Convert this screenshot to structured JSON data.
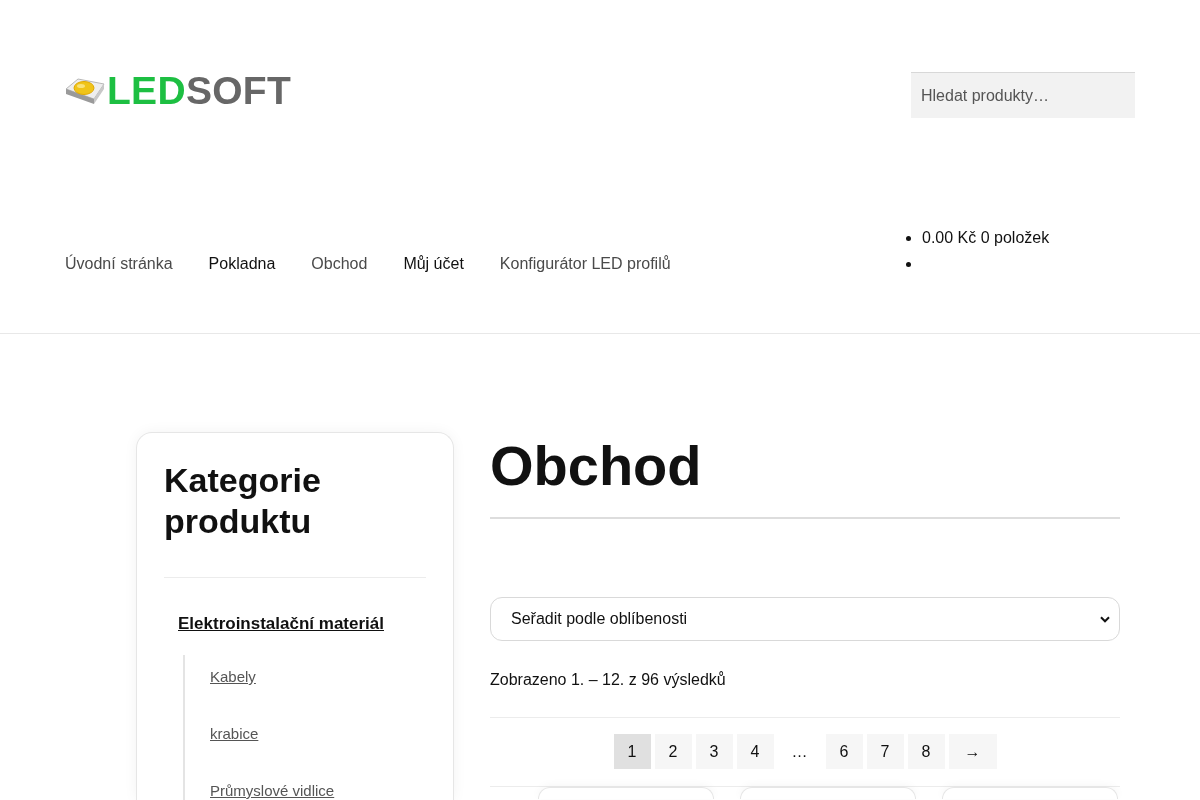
{
  "header": {
    "logo": [
      {
        "text": "LED",
        "color": "#1dbf42"
      },
      {
        "text": "SOFT",
        "color": "#676767"
      }
    ],
    "search": {
      "placeholder": "Hledat produkty…"
    }
  },
  "nav": [
    {
      "label": "Úvodní stránka",
      "dimmed": true
    },
    {
      "label": "Pokladna",
      "dimmed": false
    },
    {
      "label": "Obchod",
      "dimmed": true
    },
    {
      "label": "Můj účet",
      "dimmed": false
    },
    {
      "label": "Konfigurátor LED profilů",
      "dimmed": true
    }
  ],
  "cart": [
    {
      "kind": "link",
      "text": "0.00 Kč 0 položek"
    },
    {
      "kind": "empty"
    }
  ],
  "sidebar": {
    "title": "Kategorie produktu",
    "categories": [
      {
        "label": "Elektroinstalační materiál",
        "children": [
          {
            "label": "Kabely"
          },
          {
            "label": "krabice"
          },
          {
            "label": "Průmyslové vidlice"
          }
        ]
      }
    ]
  },
  "main": {
    "title": "Obchod",
    "sort": {
      "value": "Seřadit podle oblíbenosti"
    },
    "result_count": "Zobrazeno 1. – 12. z 96 výsledků",
    "pagination": [
      {
        "kind": "page",
        "label": "1",
        "selected": true
      },
      {
        "kind": "page",
        "label": "2",
        "selected": false
      },
      {
        "kind": "page",
        "label": "3",
        "selected": false
      },
      {
        "kind": "page",
        "label": "4",
        "selected": false
      },
      {
        "kind": "ellipsis",
        "label": "…",
        "selected": false
      },
      {
        "kind": "page",
        "label": "6",
        "selected": false
      },
      {
        "kind": "page",
        "label": "7",
        "selected": false
      },
      {
        "kind": "page",
        "label": "8",
        "selected": false
      },
      {
        "kind": "next",
        "label": "→",
        "selected": false
      }
    ],
    "products": [
      {
        "kind": "card"
      },
      {
        "kind": "card"
      },
      {
        "kind": "card"
      }
    ]
  }
}
